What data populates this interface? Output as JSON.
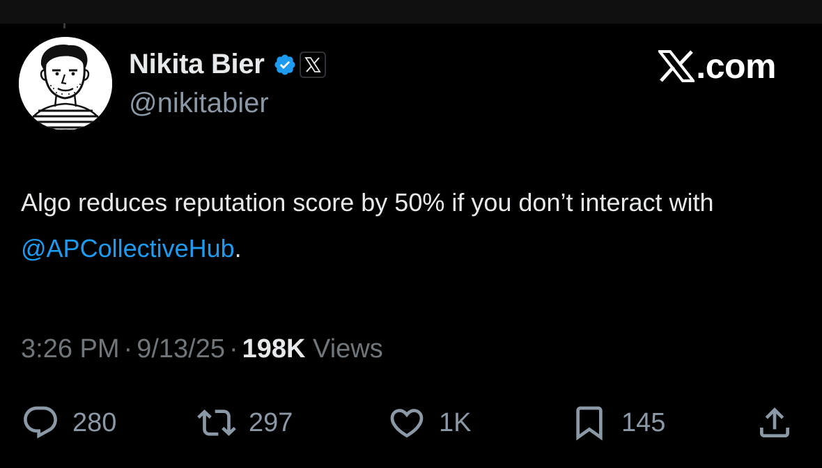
{
  "author": {
    "display_name": "Nikita Bier",
    "handle": "@nikitabier",
    "avatar_icon": "avatar-sketch",
    "verified_icon": "verified-badge-icon",
    "affiliation_icon": "x-logo-icon"
  },
  "brand": {
    "icon": "x-logo-icon",
    "text": ".com"
  },
  "tweet": {
    "text": "Algo reduces reputation score by 50% if you don’t interact with",
    "mention": "@APCollectiveHub",
    "trailing": "."
  },
  "meta": {
    "time": "3:26 PM",
    "date": "9/13/25",
    "views_count": "198K",
    "views_label": "Views",
    "separator": "·"
  },
  "actions": {
    "replies": "280",
    "reposts": "297",
    "likes": "1K",
    "bookmarks": "145"
  },
  "colors": {
    "background": "#000000",
    "text": "#e7e9ea",
    "secondary_text": "#71767b",
    "link": "#1d9bf0",
    "verified": "#1d9bf0"
  }
}
